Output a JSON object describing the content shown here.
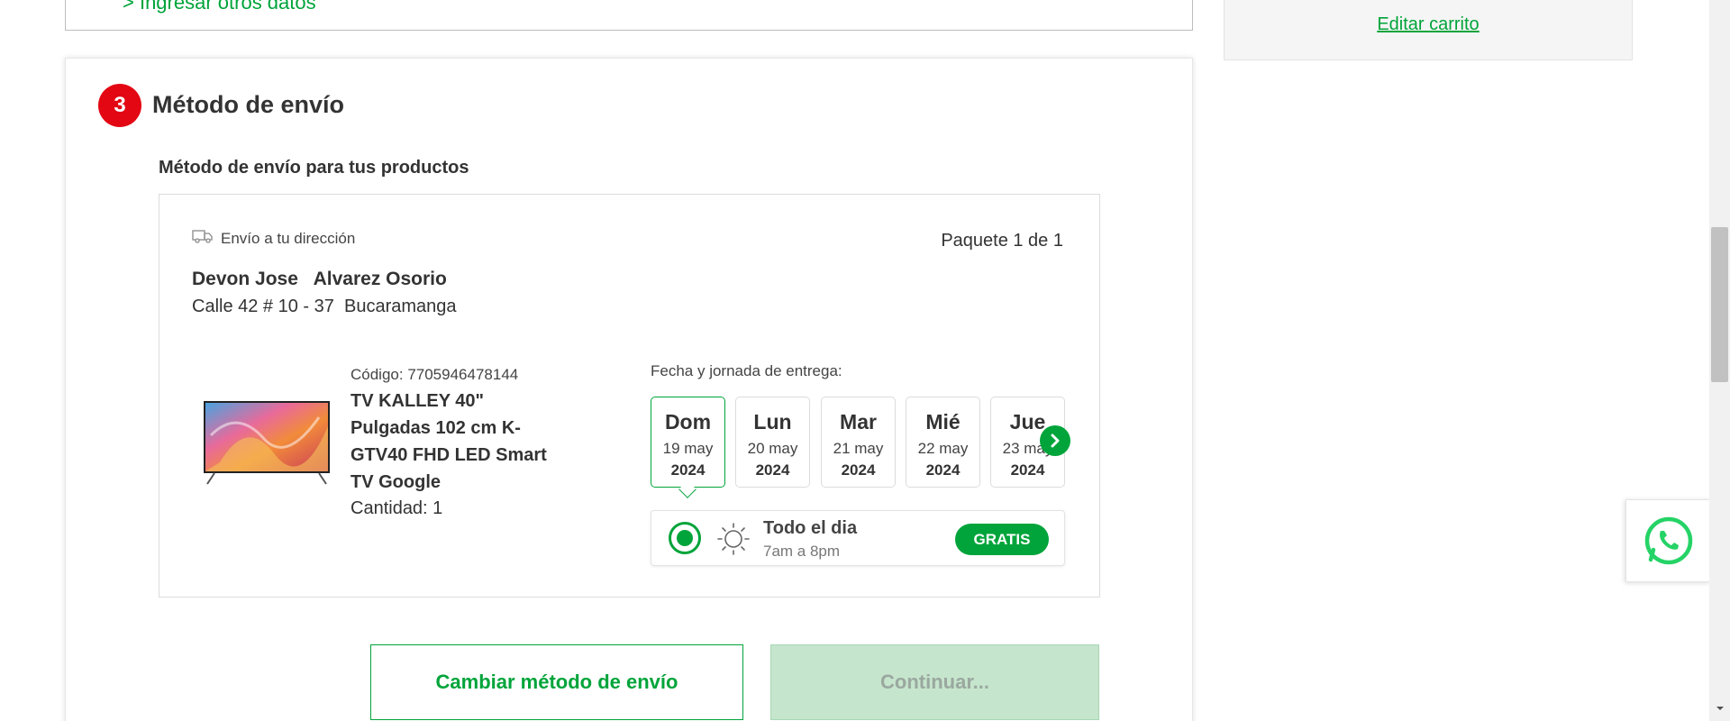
{
  "previous_section": {
    "link_label": "> Ingresar otros datos"
  },
  "summary": {
    "edit_cart_label": "Editar carrito"
  },
  "shipping": {
    "step_number": "3",
    "title": "Método de envío",
    "subtitle": "Método de envío para tus productos",
    "package": {
      "ship_type_icon": "truck-icon",
      "ship_type_label": "Envío a tu dirección",
      "package_count": "Paquete 1 de 1",
      "recipient_name": "Devon Jose   Alvarez Osorio",
      "address": "Calle 42 # 10 - 37  Bucaramanga",
      "product": {
        "code": "Código: 7705946478144",
        "name": "TV KALLEY 40\" Pulgadas 102 cm K-GTV40 FHD LED Smart TV Google",
        "quantity": "Cantidad: 1",
        "image_icon": "tv-product-image"
      },
      "date_label": "Fecha y jornada de entrega:",
      "dates": [
        {
          "dow": "Dom",
          "day_month": "19 may",
          "year": "2024",
          "selected": true
        },
        {
          "dow": "Lun",
          "day_month": "20 may",
          "year": "2024",
          "selected": false
        },
        {
          "dow": "Mar",
          "day_month": "21 may",
          "year": "2024",
          "selected": false
        },
        {
          "dow": "Mié",
          "day_month": "22 may",
          "year": "2024",
          "selected": false
        },
        {
          "dow": "Jue",
          "day_month": "23 may",
          "year": "2024",
          "selected": false
        }
      ],
      "next_icon": "chevron-right-icon",
      "slot": {
        "icon": "sun-icon",
        "title": "Todo el dia",
        "time": "7am a 8pm",
        "price_badge": "GRATIS"
      }
    },
    "buttons": {
      "change_label": "Cambiar método de envío",
      "continue_label": "Continuar..."
    }
  },
  "floating": {
    "whatsapp_icon": "whatsapp-icon"
  },
  "colors": {
    "accent_green": "#00a43a",
    "badge_red": "#e30613",
    "continue_disabled_bg": "#c6e5cd"
  }
}
